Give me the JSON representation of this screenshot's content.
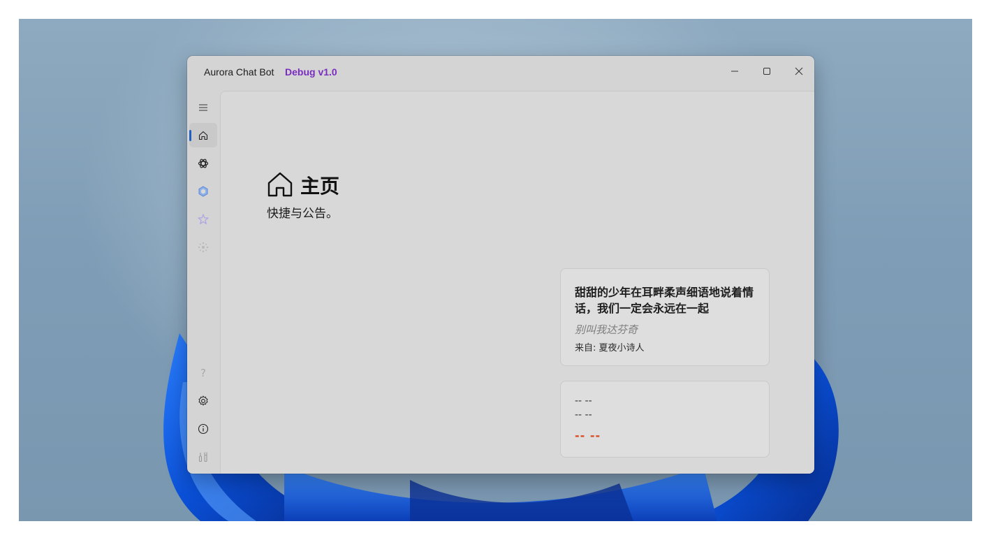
{
  "window": {
    "app_name": "Aurora Chat Bot",
    "version_label": "Debug v1.0"
  },
  "sidebar": {
    "top_items": [
      {
        "icon": "menu-icon",
        "selected": false
      },
      {
        "icon": "home-icon",
        "selected": true
      },
      {
        "icon": "openai-icon",
        "selected": false
      },
      {
        "icon": "cube-icon",
        "selected": false
      },
      {
        "icon": "star-icon",
        "selected": false
      },
      {
        "icon": "sparkle-icon",
        "selected": false
      }
    ],
    "bottom_items": [
      {
        "icon": "help-icon"
      },
      {
        "icon": "settings-icon"
      },
      {
        "icon": "info-icon"
      },
      {
        "icon": "tools-icon"
      }
    ],
    "accent_color": "#1f5fc1"
  },
  "page": {
    "title": "主页",
    "subtitle": "快捷与公告。"
  },
  "quote_card": {
    "text": "甜甜的少年在耳畔柔声细语地说着情话，我们一定会永远在一起",
    "author": "别叫我达芬奇",
    "source": "来自: 夏夜小诗人"
  },
  "status_card": {
    "line1": "-- --",
    "line2": "-- --",
    "warning": "-- --",
    "warning_color": "#d9481e"
  },
  "colors": {
    "version_label": "#7b2cc0"
  }
}
